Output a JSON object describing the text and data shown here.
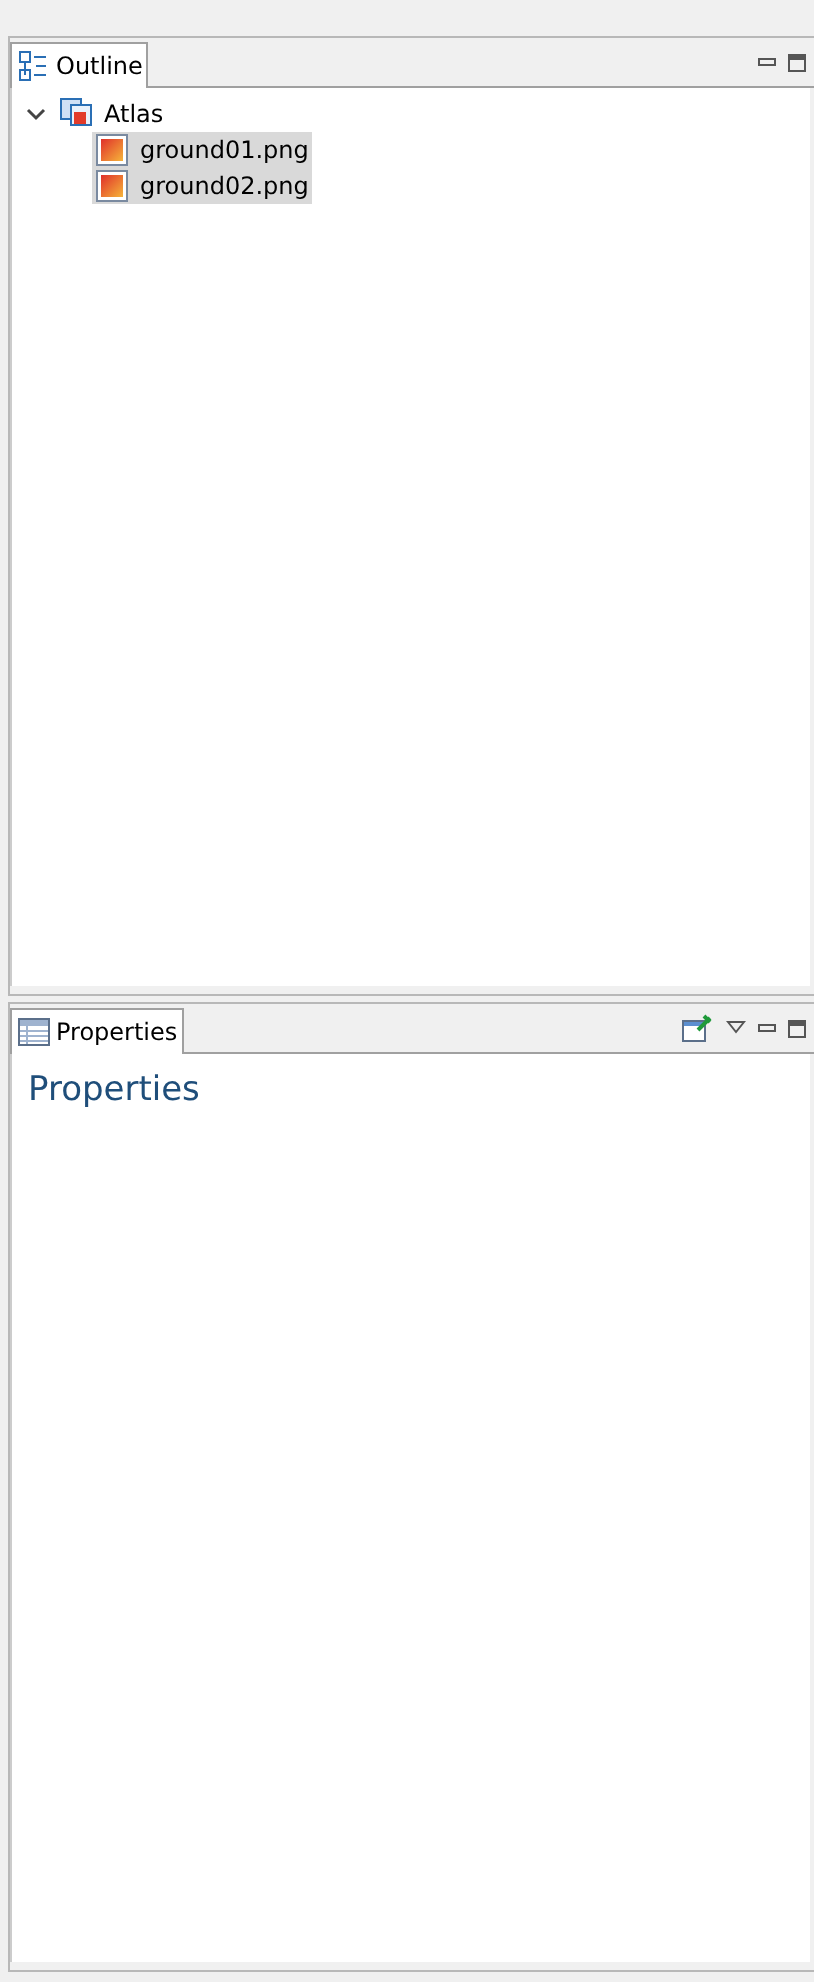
{
  "outline": {
    "tab": {
      "label": "Outline",
      "selected": true
    },
    "tree": [
      {
        "label": "Atlas",
        "expanded": true,
        "selected": false,
        "children": [
          {
            "label": "ground01.png",
            "selected": true
          },
          {
            "label": "ground02.png",
            "selected": true
          }
        ]
      }
    ]
  },
  "properties": {
    "tab": {
      "label": "Properties",
      "selected": true
    },
    "heading": "Properties"
  }
}
